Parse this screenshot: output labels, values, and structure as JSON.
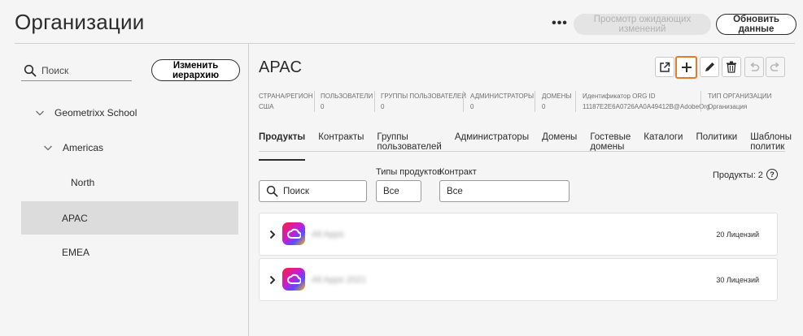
{
  "header": {
    "title": "Организации",
    "more_label": "•••",
    "pending_label": "Просмотр ожидающих изменений",
    "refresh_label": "Обновить данные"
  },
  "sidebar": {
    "search_placeholder": "Поиск",
    "edit_hierarchy_label": "Изменить иерархию",
    "tree": [
      {
        "label": "Geometrixx School"
      },
      {
        "label": "Americas"
      },
      {
        "label": "North"
      },
      {
        "label": "APAC"
      },
      {
        "label": "EMEA"
      }
    ]
  },
  "org": {
    "title": "APAC",
    "meta": [
      {
        "label": "СТРАНА/РЕГИОН",
        "value": "США"
      },
      {
        "label": "ПОЛЬЗОВАТЕЛИ",
        "value": "0"
      },
      {
        "label": "ГРУППЫ ПОЛЬЗОВАТЕЛЕЙ",
        "value": "0"
      },
      {
        "label": "АДМИНИСТРАТОРЫ",
        "value": "0"
      },
      {
        "label": "ДОМЕНЫ",
        "value": "0"
      },
      {
        "label": "Идентификатор ORG ID",
        "value": "11187E2E6A0726AA0A49412B@AdobeOrg"
      },
      {
        "label": "ТИП ОРГАНИЗАЦИИ",
        "value": "Организация"
      }
    ]
  },
  "tabs": [
    {
      "label": "Продукты"
    },
    {
      "label": "Контракты"
    },
    {
      "label": "Группы пользователей"
    },
    {
      "label": "Администраторы"
    },
    {
      "label": "Домены"
    },
    {
      "label": "Гостевые домены"
    },
    {
      "label": "Каталоги"
    },
    {
      "label": "Политики"
    },
    {
      "label": "Шаблоны политик"
    }
  ],
  "filters": {
    "search_placeholder": "Поиск",
    "product_types_label": "Типы продуктов",
    "product_types_value": "Все",
    "contract_label": "Контракт",
    "contract_value": "Все"
  },
  "products": {
    "count_label": "Продукты: 2",
    "help_symbol": "?",
    "items": [
      {
        "name": "All Apps",
        "licenses": "20 Лицензий"
      },
      {
        "name": "All Apps 2021",
        "licenses": "30 Лицензий"
      }
    ]
  },
  "colors": {
    "highlight": "#e8792b",
    "selected_bg": "#dcdcdc"
  }
}
